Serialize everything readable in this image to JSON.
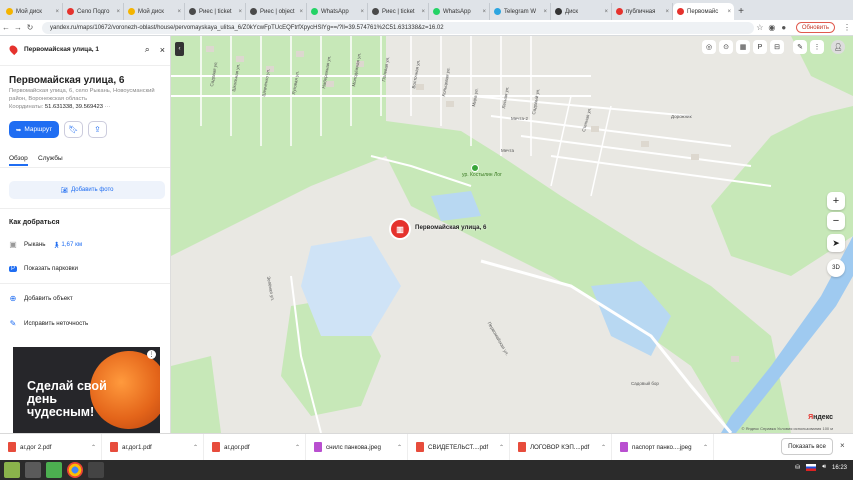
{
  "browser": {
    "tabs": [
      {
        "label": "Мой диск",
        "color": "#f4b400"
      },
      {
        "label": "Село Подго",
        "color": "#e5322d"
      },
      {
        "label": "Мой диск",
        "color": "#f4b400"
      },
      {
        "label": "Риес | ticket",
        "color": "#4a4a4a"
      },
      {
        "label": "Риес | object",
        "color": "#4a4a4a"
      },
      {
        "label": "WhatsApp",
        "color": "#25d366"
      },
      {
        "label": "Риес | ticket",
        "color": "#4a4a4a"
      },
      {
        "label": "WhatsApp",
        "color": "#25d366"
      },
      {
        "label": "Telegram W",
        "color": "#2ca5e0"
      },
      {
        "label": "Диск",
        "color": "#333333"
      },
      {
        "label": "публичная",
        "color": "#e5322d"
      },
      {
        "label": "Первомайс",
        "color": "#e5322d",
        "active": true
      }
    ],
    "url": "yandex.ru/maps/10672/voronezh-oblast/house/pervomayskaya_ulitsa_6/Z0kYcwFpTUcEQFtrfXpycHSlYg==/?ll=39.574761%2C51.631338&z=16.02",
    "update_label": "Обновить"
  },
  "panel": {
    "search_value": "Первомайская улица, 1",
    "title": "Первомайская улица, 6",
    "address": "Первомайская улица, 6, село Рыкань, Новоусманский район, Воронежская область",
    "coords_label": "Координаты:",
    "coords_value": "51.631338, 39.569423",
    "route_label": "Маршрут",
    "tab_overview": "Обзор",
    "tab_services": "Службы",
    "add_photo": "Добавить фото",
    "how_to_get": "Как добраться",
    "station": "Рыкань",
    "distance": "1,67 км",
    "show_parking": "Показать парковки",
    "add_object": "Добавить объект",
    "fix_error": "Исправить неточность",
    "ad_text": "Сделай свой день чудесным!"
  },
  "map": {
    "place_label": "Первомайская улица, 6",
    "poi_label": "ур. Костылин Лог",
    "streets": [
      "Садовая ул.",
      "Школьная ул.",
      "Шевченко ул.",
      "Луговая ул.",
      "Набережная ул.",
      "Молодёжная ул.",
      "Полевая ул.",
      "Восточная ул.",
      "Кольцевая ул.",
      "Мира ул.",
      "Лесная ул.",
      "Садовый ул.",
      "Степная ул.",
      "Дорожник",
      "Мечта-2",
      "Мечта",
      "Садовый бор",
      "Первомайская ул.",
      "Зелёная ул."
    ],
    "brand_prefix": "Я",
    "brand_suffix": "ндекс",
    "attribution": "© Яндекс  Справка  Условия использования  100 м",
    "zoom_in": "+",
    "zoom_out": "−",
    "mode_3d": "3D"
  },
  "downloads": [
    {
      "name": "аг.дог 2.pdf",
      "type": "pdf"
    },
    {
      "name": "аг.дог1.pdf",
      "type": "pdf"
    },
    {
      "name": "аг.дог.pdf",
      "type": "pdf"
    },
    {
      "name": "снилс панкова.jpeg",
      "type": "jpg"
    },
    {
      "name": "СВИДЕТЕЛЬСТ....pdf",
      "type": "pdf"
    },
    {
      "name": "ЛОГОВОР КЭП....pdf",
      "type": "pdf"
    },
    {
      "name": "паспорт панко....jpeg",
      "type": "jpg"
    }
  ],
  "downloads_show_all": "Показать все",
  "taskbar": {
    "time": "16:23"
  }
}
